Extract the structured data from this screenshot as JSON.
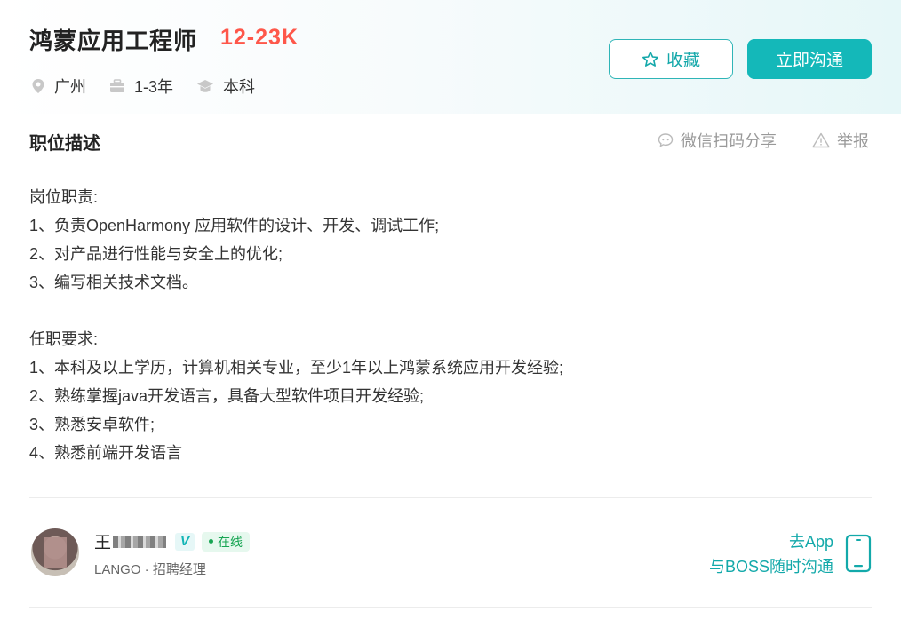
{
  "job": {
    "title": "鸿蒙应用工程师",
    "salary": "12-23K",
    "location": "广州",
    "experience": "1-3年",
    "education": "本科"
  },
  "actions": {
    "favorite_label": "收藏",
    "chat_label": "立即沟通"
  },
  "section": {
    "title": "职位描述",
    "share_label": "微信扫码分享",
    "report_label": "举报"
  },
  "description": {
    "duties_heading": "岗位职责:",
    "duties": [
      "1、负责OpenHarmony 应用软件的设计、开发、调试工作;",
      "2、对产品进行性能与安全上的优化;",
      "3、编写相关技术文档。"
    ],
    "requirements_heading": "任职要求:",
    "requirements": [
      "1、本科及以上学历，计算机相关专业，至少1年以上鸿蒙系统应用开发经验;",
      "2、熟练掌握java开发语言，具备大型软件项目开发经验;",
      "3、熟悉安卓软件;",
      "4、熟悉前端开发语言"
    ]
  },
  "recruiter": {
    "name": "王",
    "verified_badge": "V",
    "status": "在线",
    "company_title": "LANGO · 招聘经理"
  },
  "app_promo": {
    "line1": "去App",
    "line2": "与BOSS随时沟通"
  },
  "colors": {
    "accent": "#14b8b9",
    "salary": "#fe574a",
    "online": "#18a553"
  },
  "icons": [
    "location-icon",
    "briefcase-icon",
    "graduation-cap-icon",
    "star-icon",
    "wechat-chat-icon",
    "warning-icon",
    "phone-icon"
  ]
}
